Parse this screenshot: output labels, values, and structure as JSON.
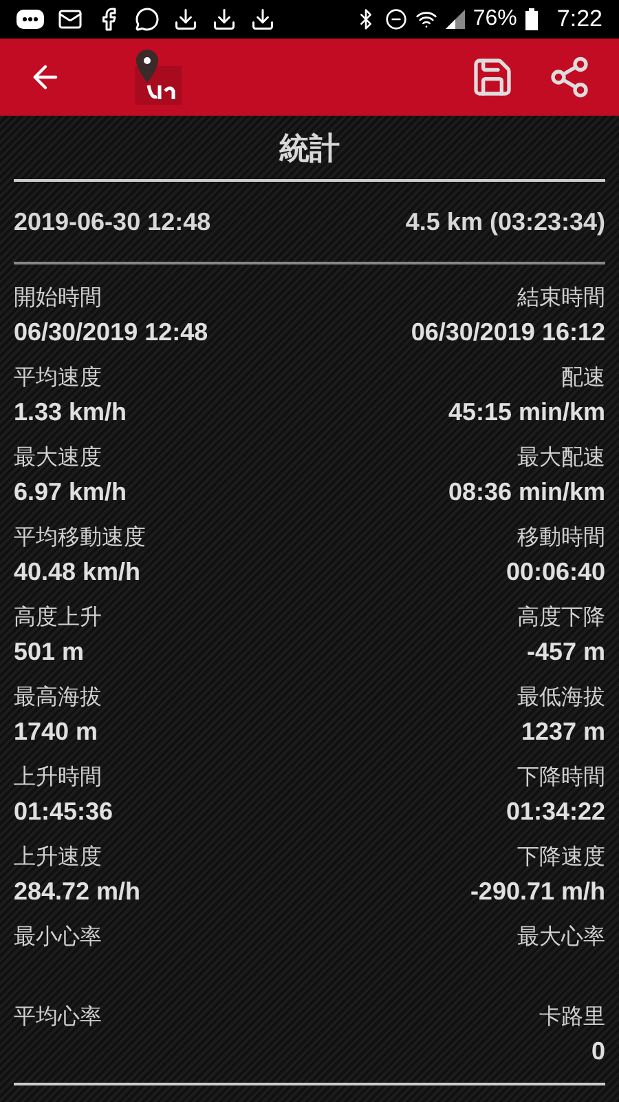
{
  "status_bar": {
    "battery": "76%",
    "time": "7:22"
  },
  "title": "統計",
  "summary": {
    "date": "2019-06-30 12:48",
    "distance": "4.5 km (03:23:34)"
  },
  "stats": [
    {
      "left": {
        "label": "開始時間",
        "value": "06/30/2019 12:48"
      },
      "right": {
        "label": "結束時間",
        "value": "06/30/2019 16:12"
      }
    },
    {
      "left": {
        "label": "平均速度",
        "value": "1.33 km/h"
      },
      "right": {
        "label": "配速",
        "value": "45:15 min/km"
      }
    },
    {
      "left": {
        "label": "最大速度",
        "value": "6.97 km/h"
      },
      "right": {
        "label": "最大配速",
        "value": "08:36 min/km"
      }
    },
    {
      "left": {
        "label": "平均移動速度",
        "value": "40.48 km/h"
      },
      "right": {
        "label": "移動時間",
        "value": "00:06:40"
      }
    },
    {
      "left": {
        "label": "高度上升",
        "value": "501 m"
      },
      "right": {
        "label": "高度下降",
        "value": "-457 m"
      }
    },
    {
      "left": {
        "label": "最高海拔",
        "value": "1740 m"
      },
      "right": {
        "label": "最低海拔",
        "value": "1237 m"
      }
    },
    {
      "left": {
        "label": "上升時間",
        "value": "01:45:36"
      },
      "right": {
        "label": "下降時間",
        "value": "01:34:22"
      }
    },
    {
      "left": {
        "label": "上升速度",
        "value": "284.72 m/h"
      },
      "right": {
        "label": "下降速度",
        "value": "-290.71 m/h"
      }
    },
    {
      "left": {
        "label": "最小心率"
      },
      "right": {
        "label": "最大心率"
      }
    },
    {
      "left": {
        "label": "平均心率"
      },
      "right": {
        "label": "卡路里",
        "value": "0"
      }
    }
  ]
}
